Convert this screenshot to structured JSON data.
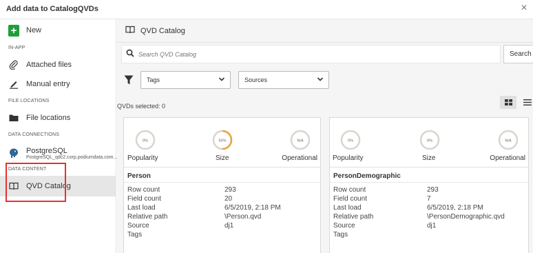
{
  "dialog": {
    "title": "Add data to CatalogQVDs",
    "close_label": "×"
  },
  "sidebar": {
    "new_label": "New",
    "section_inapp": "IN-APP",
    "attached_files": "Attached files",
    "manual_entry": "Manual entry",
    "section_file_locations": "FILE LOCATIONS",
    "file_locations": "File locations",
    "section_data_connections": "DATA CONNECTIONS",
    "postgres_label": "PostgreSQL",
    "postgres_sub": "PostgreSQL_qdc2.corp.podiumdata.com...",
    "section_data_content": "DATA CONTENT",
    "qvd_catalog": "QVD Catalog"
  },
  "main": {
    "crumb": "QVD Catalog",
    "search_placeholder": "Search QVD Catalog",
    "search_button": "Search",
    "tags_dropdown": "Tags",
    "sources_dropdown": "Sources",
    "selected_text": "QVDs selected: 0"
  },
  "labels": {
    "popularity": "Popularity",
    "size": "Size",
    "operational": "Operational",
    "row_count": "Row count",
    "field_count": "Field count",
    "last_load": "Last load",
    "relative_path": "Relative path",
    "source": "Source",
    "tags": "Tags"
  },
  "cards": [
    {
      "name": "Person",
      "popularity": "0%",
      "size": "50%",
      "size_fraction": 0.5,
      "operational": "N/A",
      "row_count": "293",
      "field_count": "20",
      "last_load": "6/5/2019, 2:18 PM",
      "relative_path": "\\Person.qvd",
      "source": "dj1"
    },
    {
      "name": "PersonDemographic",
      "popularity": "0%",
      "size": "0%",
      "size_fraction": 0,
      "operational": "N/A",
      "row_count": "293",
      "field_count": "7",
      "last_load": "6/5/2019, 2:18 PM",
      "relative_path": "\\PersonDemographic.qvd",
      "source": "dj1"
    }
  ],
  "colors": {
    "accent_ring": "#e8a33d",
    "ring_track": "#d9d6cf",
    "new_green": "#1f9e3a",
    "highlight_red": "#e53030"
  }
}
